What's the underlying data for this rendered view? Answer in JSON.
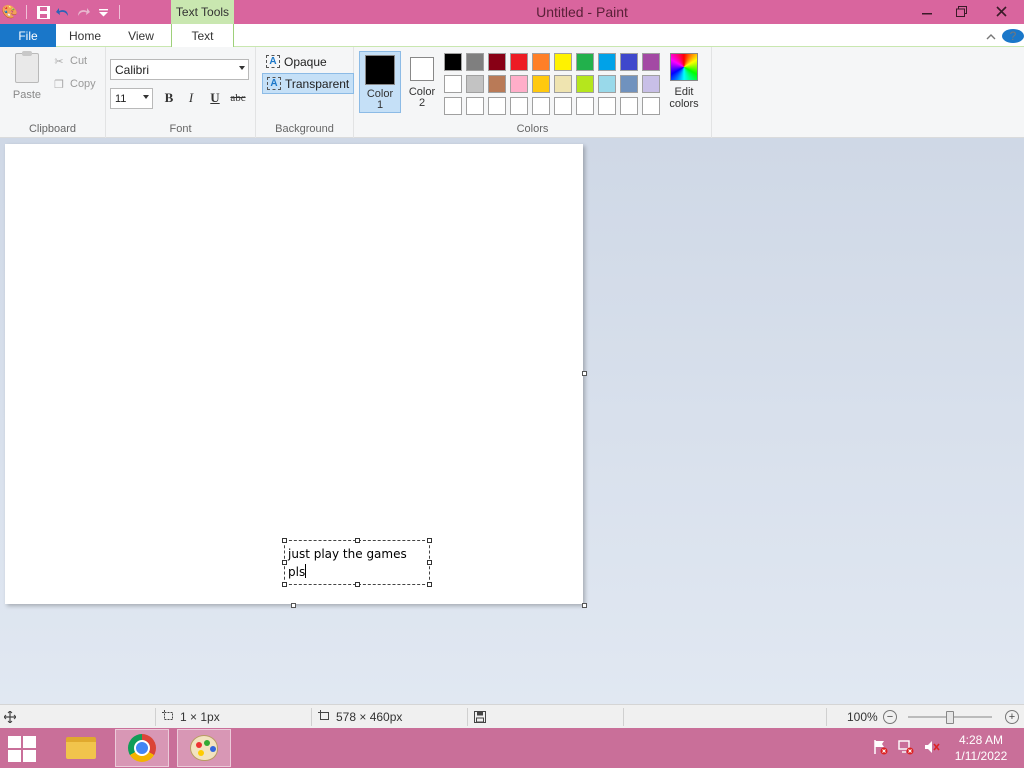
{
  "window": {
    "title": "Untitled - Paint",
    "contextual_tab": "Text Tools"
  },
  "tabs": {
    "file": "File",
    "home": "Home",
    "view": "View",
    "text": "Text"
  },
  "clipboard": {
    "paste": "Paste",
    "cut": "Cut",
    "copy": "Copy",
    "label": "Clipboard"
  },
  "font": {
    "family": "Calibri",
    "size": "11",
    "bold": "B",
    "italic": "I",
    "underline": "U",
    "strikethrough": "abc",
    "label": "Font"
  },
  "background": {
    "opaque": "Opaque",
    "transparent": "Transparent",
    "selected": "transparent",
    "label": "Background"
  },
  "colors": {
    "color1_label_a": "Color",
    "color1_label_b": "1",
    "color2_label_a": "Color",
    "color2_label_b": "2",
    "color1": "#000000",
    "color2": "#ffffff",
    "edit_label_a": "Edit",
    "edit_label_b": "colors",
    "label": "Colors",
    "palette": [
      "#000000",
      "#7f7f7f",
      "#880015",
      "#ed1c24",
      "#ff7f27",
      "#fff200",
      "#22b14c",
      "#00a2e8",
      "#3f48cc",
      "#a349a4",
      "#ffffff",
      "#c3c3c3",
      "#b97a57",
      "#ffaec9",
      "#ffc90e",
      "#efe4b0",
      "#b5e61d",
      "#99d9ea",
      "#7092be",
      "#c8bfe7",
      "#ffffff",
      "#ffffff",
      "#ffffff",
      "#ffffff",
      "#ffffff",
      "#ffffff",
      "#ffffff",
      "#ffffff",
      "#ffffff",
      "#ffffff"
    ]
  },
  "canvas": {
    "text_line1": "just play the games",
    "text_line2": "pls"
  },
  "status": {
    "selection_size": "1 × 1px",
    "image_size": "578 × 460px",
    "zoom": "100%",
    "zoom_fraction": 0.5
  },
  "taskbar": {
    "time": "4:28 AM",
    "date": "1/11/2022"
  }
}
